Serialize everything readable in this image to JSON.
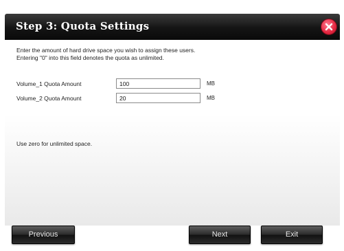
{
  "dialog": {
    "title": "Step 3: Quota Settings"
  },
  "content": {
    "description_line1": "Enter the amount of hard drive space you wish to assign these users.",
    "description_line2": "Entering \"0\" into this field denotes the quota as unlimited.",
    "volumes": [
      {
        "label": "Volume_1 Quota Amount",
        "value": "100",
        "unit": "MB"
      },
      {
        "label": "Volume_2 Quota Amount",
        "value": "20",
        "unit": "MB"
      }
    ],
    "hint": "Use zero for unlimited space."
  },
  "footer": {
    "previous_label": "Previous",
    "next_label": "Next",
    "exit_label": "Exit"
  },
  "colors": {
    "titlebar": "#141414",
    "close_button": "#e3263f",
    "button": "#2a2a2a"
  }
}
